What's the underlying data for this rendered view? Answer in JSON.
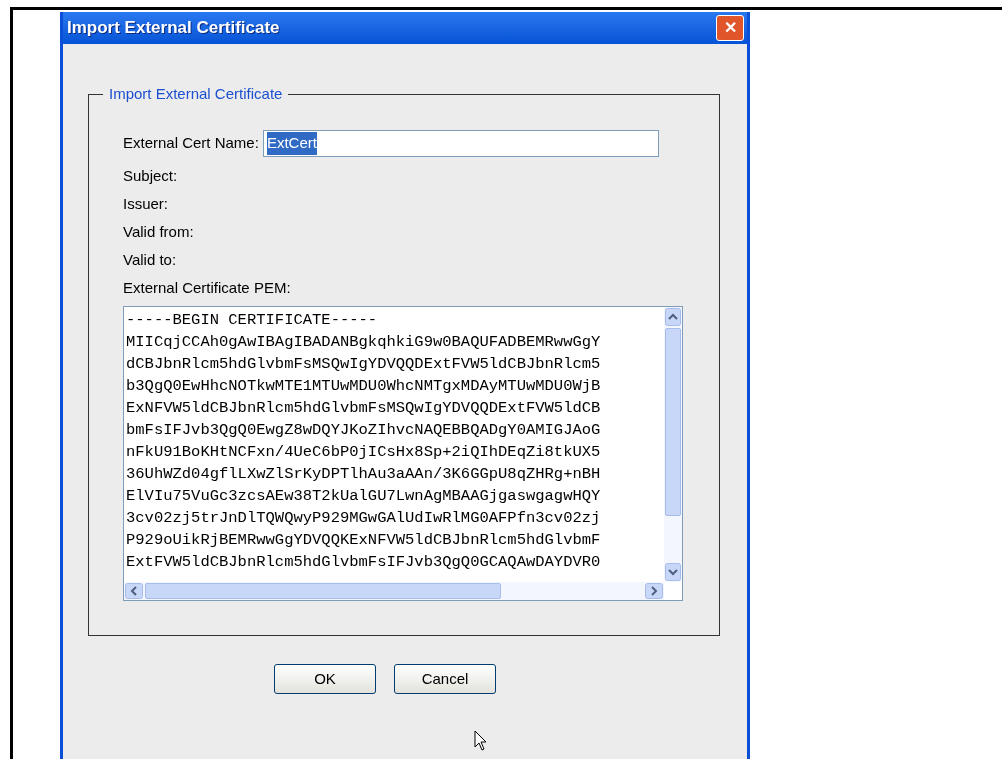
{
  "window": {
    "title": "Import External Certificate",
    "close": "✕"
  },
  "group": {
    "legend": "Import External Certificate"
  },
  "name_field": {
    "label": "External Cert Name:",
    "value": "ExtCert",
    "text_selected": true
  },
  "info_labels": [
    "Subject:",
    "Issuer:",
    "Valid from:",
    "Valid to:"
  ],
  "pem": {
    "label": "External Certificate PEM:",
    "lines": [
      "-----BEGIN CERTIFICATE-----",
      "MIICqjCCAh0gAwIBAgIBADANBgkqhkiG9w0BAQUFADBEMRwwGgY",
      "dCBJbnRlcm5hdGlvbmFsMSQwIgYDVQQDExtFVW5ldCBJbnRlcm5",
      "b3QgQ0EwHhcNOTkwMTE1MTUwMDU0WhcNMTgxMDAyMTUwMDU0WjB",
      "ExNFVW5ldCBJbnRlcm5hdGlvbmFsMSQwIgYDVQQDExtFVW5ldCB",
      "bmFsIFJvb3QgQ0EwgZ8wDQYJKoZIhvcNAQEBBQADgY0AMIGJAoG",
      "nFkU91BoKHtNCFxn/4UeC6bP0jICsHx8Sp+2iQIhDEqZi8tkUX5",
      "36UhWZd04gflLXwZlSrKyDPTlhAu3aAAn/3K6GGpU8qZHRg+nBH",
      "ElVIu75VuGc3zcsAEw38T2kUalGU7LwnAgMBAAGjgaswgagwHQY",
      "3cv02zj5trJnDlTQWQwyP929MGwGAlUdIwRlMG0AFPfn3cv02zj",
      "P929oUikRjBEMRwwGgYDVQQKExNFVW5ldCBJbnRlcm5hdGlvbmF",
      "ExtFVW5ldCBJbnRlcm5hdGlvbmFsIFJvb3QgQ0GCAQAwDAYDVR0"
    ]
  },
  "buttons": [
    "OK",
    "Cancel"
  ]
}
